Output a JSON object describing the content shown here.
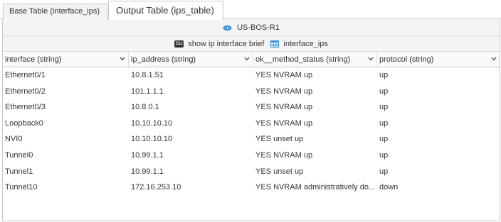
{
  "tabs": [
    {
      "label": "Base Table (interface_ips)",
      "active": false
    },
    {
      "label": "Output Table (ips_table)",
      "active": true
    }
  ],
  "device": {
    "name": "US-BOS-R1",
    "icon": "router-icon"
  },
  "command": {
    "cli_badge": "CLI",
    "text": "show ip interface brief",
    "table_name": "interface_ips"
  },
  "columns": [
    "interface (string)",
    "ip_address (string)",
    "ok__method_status (string)",
    "protocol (string)"
  ],
  "rows": [
    [
      "Ethernet0/1",
      "10.8.1.51",
      "YES NVRAM up",
      "up"
    ],
    [
      "Ethernet0/2",
      "101.1.1.1",
      "YES NVRAM up",
      "up"
    ],
    [
      "Ethernet0/3",
      "10.8.0.1",
      "YES NVRAM up",
      "up"
    ],
    [
      "Loopback0",
      "10.10.10.10",
      "YES NVRAM up",
      "up"
    ],
    [
      "NVI0",
      "10.10.10.10",
      "YES unset up",
      "up"
    ],
    [
      "Tunnel0",
      "10.99.1.1",
      "YES NVRAM up",
      "up"
    ],
    [
      "Tunnel1",
      "10.99.1.1",
      "YES unset up",
      "up"
    ],
    [
      "Tunnel10",
      "172.16.253.10",
      "YES NVRAM administratively do...",
      "down"
    ]
  ],
  "colors": {
    "border": "#c8c8c8",
    "router_icon": "#3b8fd6",
    "table_icon": "#3b8fd6"
  }
}
